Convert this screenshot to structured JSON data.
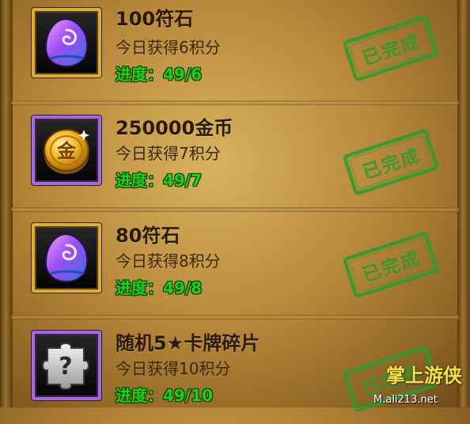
{
  "tasks": [
    {
      "icon": "rune-stone-icon",
      "title": "100符石",
      "points": "今日获得6积分",
      "progress_label": "进度：",
      "progress_value": "49/6",
      "status": "已完成"
    },
    {
      "icon": "gold-coin-icon",
      "title": "250000金币",
      "points": "今日获得7积分",
      "progress_label": "进度：",
      "progress_value": "49/7",
      "status": "已完成"
    },
    {
      "icon": "rune-stone-icon",
      "title": "80符石",
      "points": "今日获得8积分",
      "progress_label": "进度：",
      "progress_value": "49/8",
      "status": "已完成"
    },
    {
      "icon": "card-fragment-icon",
      "title": "随机5★卡牌碎片",
      "points": "今日获得10积分",
      "progress_label": "进度：",
      "progress_value": "49/10",
      "status": "已完成"
    }
  ],
  "watermark": {
    "top": "掌上游侠",
    "bottom": "M.ali213.net"
  },
  "colors": {
    "progress": "#23d012",
    "stamp": "#2e9a33",
    "icon_border_gold": "#d9ad3a",
    "icon_border_purple": "#a26bd6"
  }
}
